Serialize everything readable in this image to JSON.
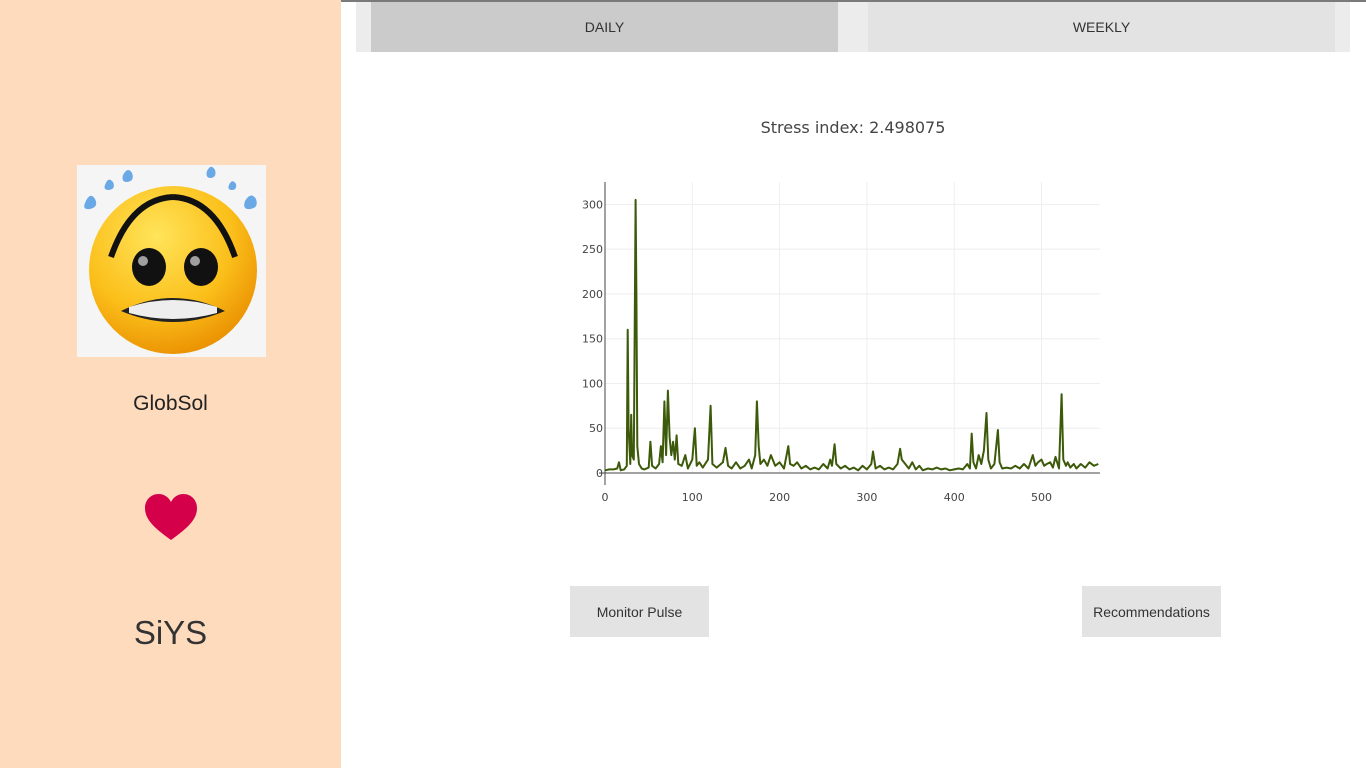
{
  "sidebar": {
    "company": "GlobSol",
    "brand": "SiYS",
    "avatar_icon": "anxious-face-icon",
    "heart_icon": "heart-icon",
    "heart_color": "#d5004a"
  },
  "tabs": [
    {
      "label": "DAILY",
      "active": true
    },
    {
      "label": "WEEKLY",
      "active": false
    }
  ],
  "stress_text": "Stress index: 2.498075",
  "buttons": {
    "monitor": "Monitor Pulse",
    "recommendations": "Recommendations"
  },
  "colors": {
    "sidebar_bg": "#fedbbd",
    "line": "#3d5a0a"
  },
  "chart_data": {
    "type": "line",
    "title": "",
    "xlabel": "",
    "ylabel": "",
    "xlim": [
      0,
      567
    ],
    "ylim": [
      0,
      325
    ],
    "xticks": [
      0,
      100,
      200,
      300,
      400,
      500
    ],
    "yticks": [
      0,
      50,
      100,
      150,
      200,
      250,
      300
    ],
    "grid": true,
    "series": [
      {
        "values": [
          [
            0,
            3
          ],
          [
            5,
            4
          ],
          [
            10,
            4
          ],
          [
            14,
            5
          ],
          [
            16,
            12
          ],
          [
            18,
            3
          ],
          [
            22,
            4
          ],
          [
            25,
            8
          ],
          [
            26,
            160
          ],
          [
            27,
            50
          ],
          [
            29,
            10
          ],
          [
            30,
            65
          ],
          [
            31,
            20
          ],
          [
            33,
            15
          ],
          [
            35,
            305
          ],
          [
            36,
            200
          ],
          [
            37,
            30
          ],
          [
            39,
            10
          ],
          [
            42,
            5
          ],
          [
            45,
            4
          ],
          [
            50,
            6
          ],
          [
            52,
            35
          ],
          [
            54,
            8
          ],
          [
            58,
            5
          ],
          [
            62,
            10
          ],
          [
            64,
            30
          ],
          [
            66,
            12
          ],
          [
            68,
            80
          ],
          [
            70,
            20
          ],
          [
            72,
            92
          ],
          [
            74,
            40
          ],
          [
            76,
            20
          ],
          [
            78,
            35
          ],
          [
            80,
            15
          ],
          [
            82,
            42
          ],
          [
            84,
            10
          ],
          [
            88,
            8
          ],
          [
            92,
            20
          ],
          [
            95,
            5
          ],
          [
            100,
            15
          ],
          [
            103,
            50
          ],
          [
            105,
            8
          ],
          [
            108,
            12
          ],
          [
            112,
            6
          ],
          [
            118,
            15
          ],
          [
            121,
            75
          ],
          [
            123,
            10
          ],
          [
            128,
            6
          ],
          [
            135,
            12
          ],
          [
            138,
            28
          ],
          [
            141,
            8
          ],
          [
            145,
            5
          ],
          [
            150,
            12
          ],
          [
            155,
            5
          ],
          [
            160,
            8
          ],
          [
            165,
            15
          ],
          [
            168,
            5
          ],
          [
            172,
            20
          ],
          [
            174,
            80
          ],
          [
            176,
            30
          ],
          [
            178,
            10
          ],
          [
            182,
            15
          ],
          [
            186,
            8
          ],
          [
            190,
            20
          ],
          [
            195,
            8
          ],
          [
            200,
            12
          ],
          [
            205,
            5
          ],
          [
            208,
            20
          ],
          [
            210,
            30
          ],
          [
            212,
            10
          ],
          [
            216,
            8
          ],
          [
            220,
            12
          ],
          [
            225,
            5
          ],
          [
            230,
            8
          ],
          [
            235,
            4
          ],
          [
            240,
            6
          ],
          [
            245,
            4
          ],
          [
            250,
            10
          ],
          [
            255,
            5
          ],
          [
            258,
            15
          ],
          [
            260,
            8
          ],
          [
            263,
            32
          ],
          [
            265,
            10
          ],
          [
            270,
            5
          ],
          [
            275,
            8
          ],
          [
            280,
            4
          ],
          [
            285,
            6
          ],
          [
            290,
            3
          ],
          [
            295,
            8
          ],
          [
            300,
            4
          ],
          [
            305,
            10
          ],
          [
            307,
            24
          ],
          [
            310,
            5
          ],
          [
            315,
            8
          ],
          [
            320,
            4
          ],
          [
            325,
            6
          ],
          [
            330,
            4
          ],
          [
            335,
            10
          ],
          [
            338,
            27
          ],
          [
            340,
            15
          ],
          [
            344,
            10
          ],
          [
            348,
            5
          ],
          [
            352,
            12
          ],
          [
            356,
            4
          ],
          [
            360,
            8
          ],
          [
            364,
            3
          ],
          [
            370,
            5
          ],
          [
            375,
            4
          ],
          [
            380,
            6
          ],
          [
            385,
            4
          ],
          [
            390,
            5
          ],
          [
            395,
            3
          ],
          [
            400,
            4
          ],
          [
            405,
            5
          ],
          [
            410,
            4
          ],
          [
            415,
            10
          ],
          [
            418,
            5
          ],
          [
            420,
            44
          ],
          [
            422,
            12
          ],
          [
            425,
            5
          ],
          [
            428,
            20
          ],
          [
            431,
            10
          ],
          [
            434,
            25
          ],
          [
            437,
            67
          ],
          [
            439,
            15
          ],
          [
            442,
            5
          ],
          [
            446,
            10
          ],
          [
            450,
            48
          ],
          [
            452,
            12
          ],
          [
            455,
            5
          ],
          [
            460,
            6
          ],
          [
            465,
            5
          ],
          [
            470,
            8
          ],
          [
            475,
            5
          ],
          [
            480,
            10
          ],
          [
            485,
            5
          ],
          [
            490,
            20
          ],
          [
            493,
            8
          ],
          [
            496,
            12
          ],
          [
            500,
            15
          ],
          [
            503,
            8
          ],
          [
            506,
            10
          ],
          [
            510,
            12
          ],
          [
            513,
            6
          ],
          [
            516,
            18
          ],
          [
            520,
            5
          ],
          [
            523,
            88
          ],
          [
            525,
            15
          ],
          [
            528,
            8
          ],
          [
            530,
            12
          ],
          [
            533,
            6
          ],
          [
            537,
            10
          ],
          [
            540,
            5
          ],
          [
            545,
            10
          ],
          [
            550,
            6
          ],
          [
            555,
            12
          ],
          [
            560,
            8
          ],
          [
            565,
            10
          ]
        ]
      }
    ]
  }
}
